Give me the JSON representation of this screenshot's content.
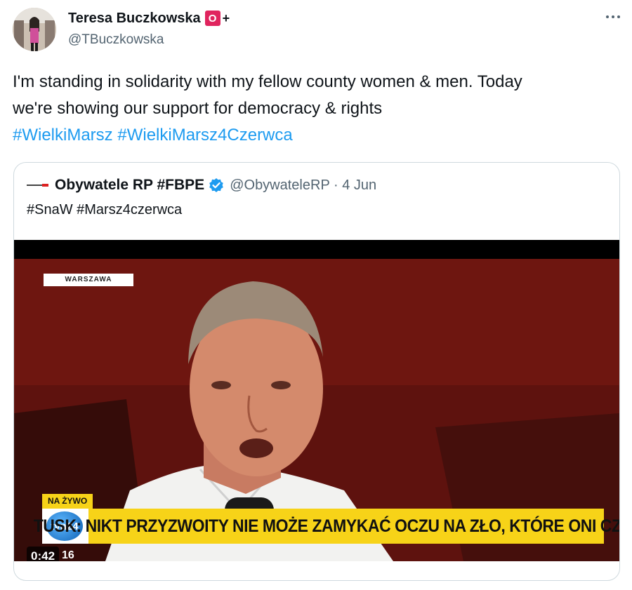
{
  "tweet": {
    "author_name": "Teresa Buczkowska",
    "badge_label": "O",
    "badge_suffix": "+",
    "handle": "@TBuczkowska",
    "text_line1": "I'm standing in solidarity with my fellow county women & men. Today",
    "text_line2": "we're showing our support for democracy & rights",
    "hashtags": [
      "#WielkiMarsz",
      "#WielkiMarsz4Czerwca"
    ],
    "more_icon": "more-horizontal-icon"
  },
  "quoted": {
    "name": "Obywatele RP #FBPE",
    "verified_icon": "verified-badge-icon",
    "handle_date": "@ObywateleRP · 4 Jun",
    "text": "#SnaW #Marsz4czerwca",
    "video": {
      "location_label": "WARSZAWA",
      "live_label": "NA ŻYWO",
      "channel_logo": "tvn24",
      "ticker": "TUSK: NIKT PRZYZWOITY NIE MOŻE ZAMYKAĆ OCZU NA ZŁO, KTÓRE ONI CZYNIĄ",
      "elapsed": "0:42",
      "clock_fragment": "16"
    }
  },
  "colors": {
    "link": "#1d9bf0",
    "secondary_text": "#536471",
    "ticker_yellow": "#f7d318",
    "badge_red": "#e0245e",
    "verified_blue": "#1d9bf0"
  }
}
